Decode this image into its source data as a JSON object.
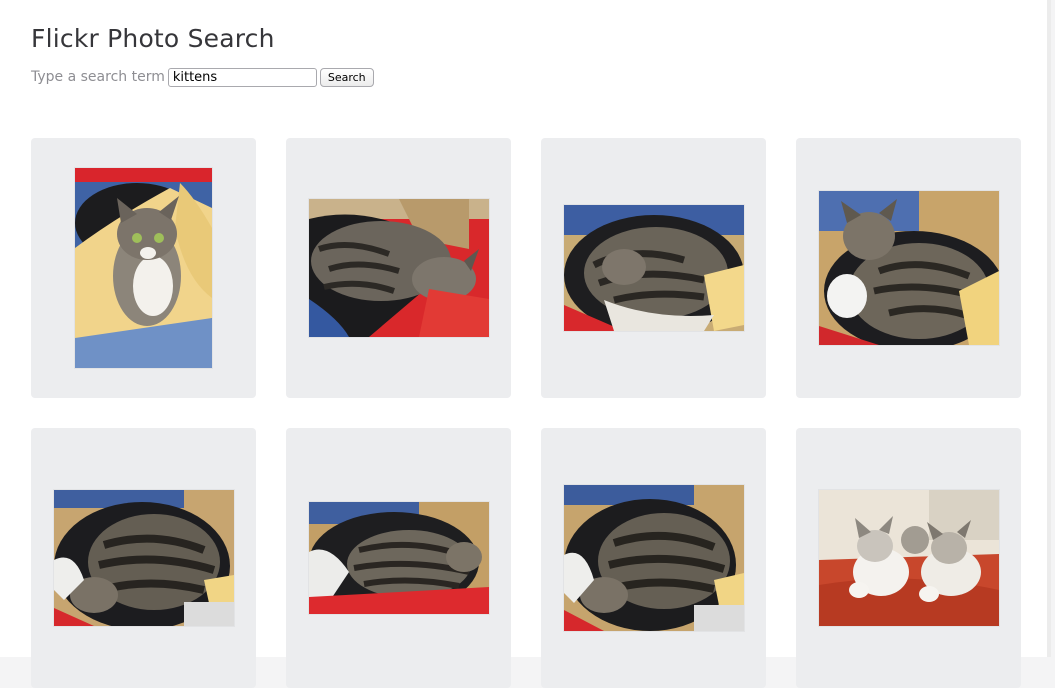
{
  "page": {
    "title": "Flickr Photo Search"
  },
  "search": {
    "label": "Type a search term",
    "value": "kittens",
    "button_label": "Search"
  },
  "results": {
    "photos": [
      {
        "subject": "kitten in laundry basket on yellow towel"
      },
      {
        "subject": "tabby kitten sleeping on red cloth"
      },
      {
        "subject": "tabby kitten curled in basket"
      },
      {
        "subject": "tabby kitten sitting in basket"
      },
      {
        "subject": "tabby kitten asleep in black basket"
      },
      {
        "subject": "tabby kitten lying in basket on red"
      },
      {
        "subject": "tabby kitten curled asleep in basket"
      },
      {
        "subject": "three kittens on red blanket"
      }
    ]
  },
  "colors": {
    "card_background": "#ecedef",
    "title_text": "#36363a",
    "label_text": "#8e8e93"
  }
}
